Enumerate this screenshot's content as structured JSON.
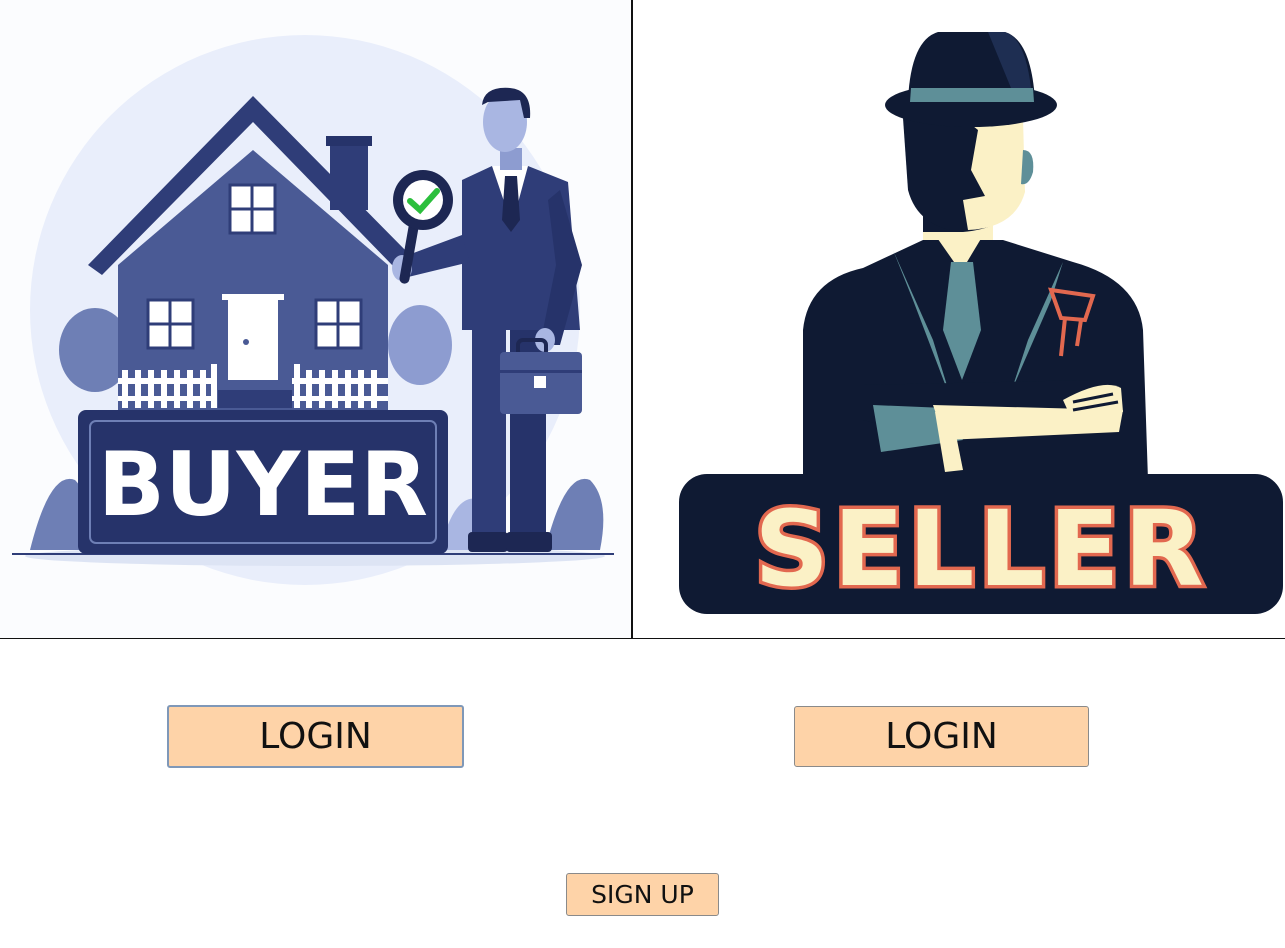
{
  "buyer": {
    "banner_text": "BUYER",
    "login_label": "LOGIN",
    "colors": {
      "navy": "#2f3d78",
      "light": "#e9eefb",
      "accent_green": "#2bbf3c"
    }
  },
  "seller": {
    "banner_text": "SELLER",
    "login_label": "LOGIN",
    "colors": {
      "dark": "#0f1a33",
      "cream": "#fbf1c6",
      "accent_red": "#e2684f",
      "teal": "#5e8f98"
    }
  },
  "signup": {
    "label": "SIGN UP"
  },
  "button_color": "#fed3a8"
}
